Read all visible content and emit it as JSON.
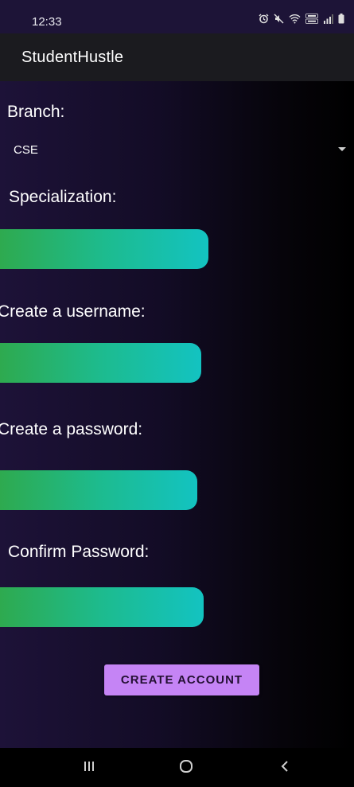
{
  "status_bar": {
    "time": "12:33",
    "icons": [
      "alarm-icon",
      "mute-icon",
      "wifi-icon",
      "volte-icon",
      "signal-icon",
      "battery-icon"
    ]
  },
  "toolbar": {
    "title": "StudentHustle"
  },
  "form": {
    "branch_label": "Branch:",
    "branch_value": "CSE",
    "specialization_label": "Specialization:",
    "specialization_value": "",
    "username_label": "Create a username:",
    "username_value": "",
    "password_label": "Create a password:",
    "password_value": "",
    "confirm_label": "Confirm Password:",
    "confirm_value": "",
    "submit_label": "CREATE ACCOUNT"
  },
  "nav_bar": {
    "buttons": [
      "recents-icon",
      "home-icon",
      "back-icon"
    ]
  },
  "colors": {
    "accent_button": "#c584f5",
    "field_gradient_start": "#2eaa4f",
    "field_gradient_end": "#13c3c1",
    "toolbar": "#1b1b1f"
  }
}
